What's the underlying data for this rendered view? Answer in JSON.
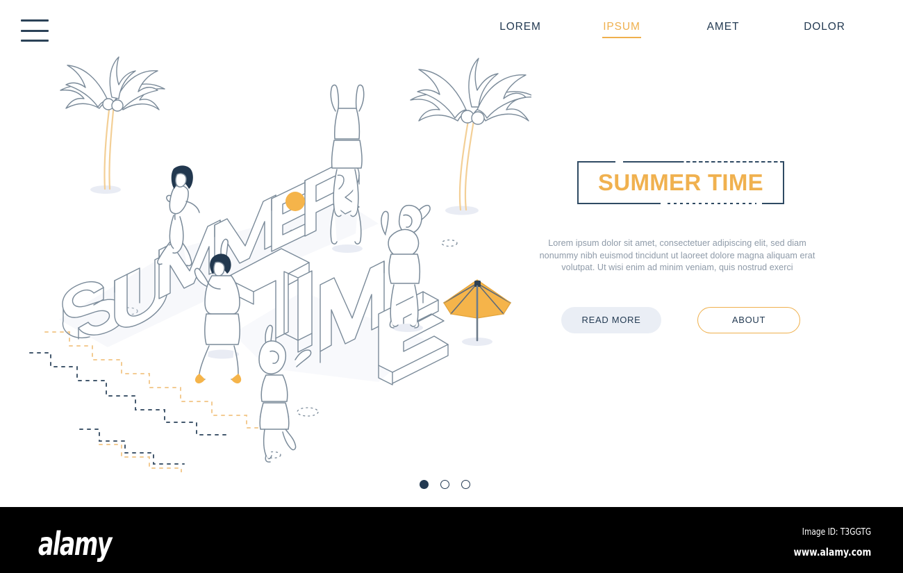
{
  "header": {
    "menu_icon": "hamburger-menu-icon",
    "nav": [
      {
        "label": "LOREM",
        "active": false
      },
      {
        "label": "IPSUM",
        "active": true
      },
      {
        "label": "AMET",
        "active": false
      },
      {
        "label": "DOLOR",
        "active": false
      }
    ]
  },
  "hero": {
    "title": "SUMMER TIME",
    "body": "Lorem ipsum dolor sit amet, consectetuer adipiscing elit, sed diam nonummy nibh euismod tincidunt ut laoreet dolore magna aliquam erat volutpat. Ut wisi enim ad minim veniam, quis nostrud exerci",
    "buttons": {
      "primary": "READ MORE",
      "secondary": "ABOUT"
    }
  },
  "carousel": {
    "dots": [
      {
        "label": "slide-1",
        "active": true
      },
      {
        "label": "slide-2",
        "active": false
      },
      {
        "label": "slide-3",
        "active": false
      }
    ]
  },
  "illustration": {
    "word_top": "SUMMER",
    "word_bottom": "TIME",
    "description": "Isometric line-art beach scene with 3D outlined letters, palm trees, dancing figures, beach ball and parasol"
  },
  "watermark": {
    "logo": "alamy",
    "image_id": "Image ID: T3GGTG",
    "url": "www.alamy.com"
  },
  "colors": {
    "accent_orange": "#efb04d",
    "ball_orange": "#f5ae4d",
    "navy": "#233a52",
    "frame_navy": "#2f4a63",
    "body_gray": "#8e9aa8",
    "line_gray": "#7a8a99",
    "button_fill": "#eaeef5",
    "shadow": "#e8ebf3",
    "background": "#ffffff",
    "watermark_bg": "#000000"
  }
}
